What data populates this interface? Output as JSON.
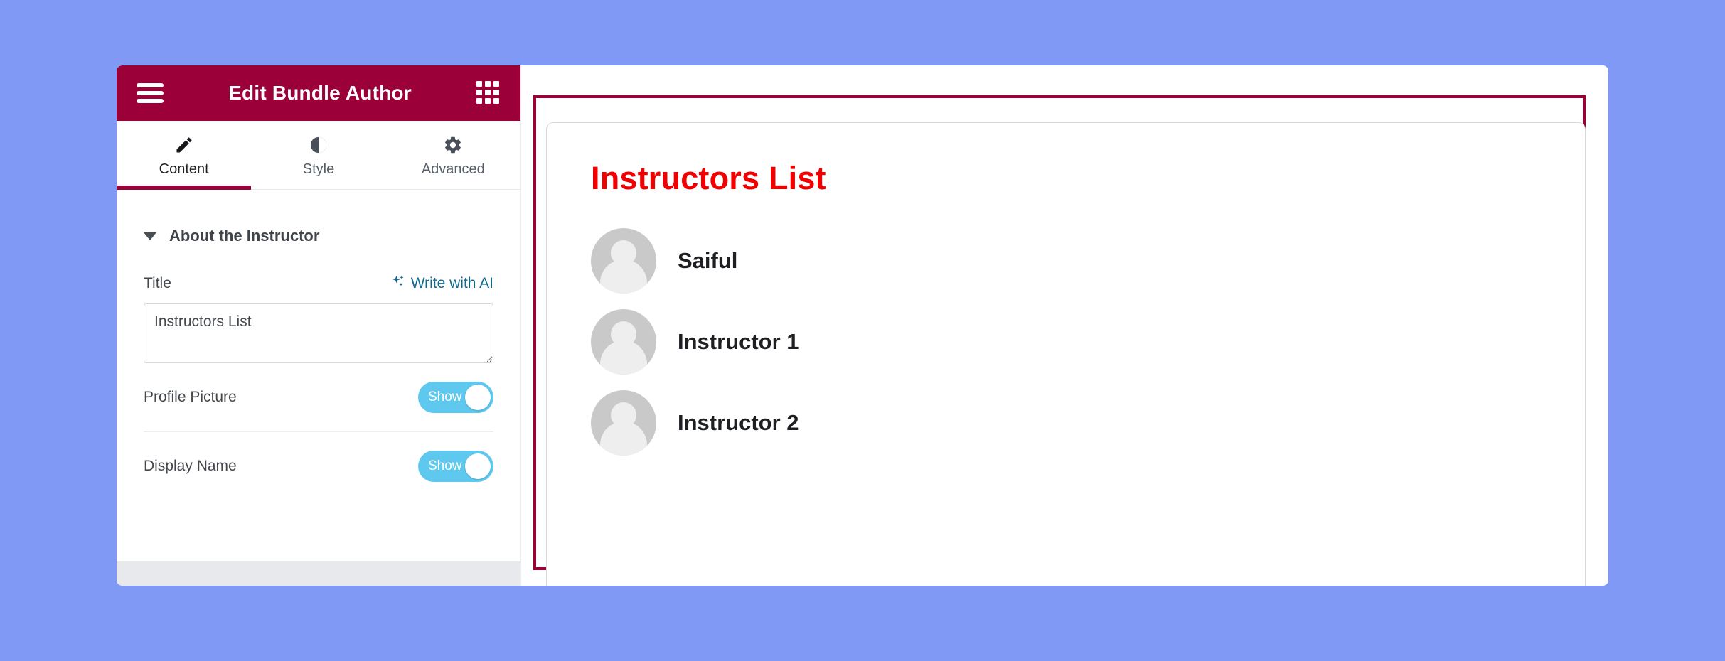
{
  "theme": {
    "background": "#8099f5",
    "header_bar": "#9b0039",
    "accent": "#9b0039",
    "toggle_on": "#5ec8ef",
    "link": "#11698e",
    "preview_heading": "#f00000"
  },
  "panel": {
    "header": {
      "title": "Edit Bundle Author",
      "menu_icon": "hamburger-icon",
      "apps_icon": "grid-icon"
    },
    "tabs": [
      {
        "label": "Content",
        "icon": "pencil-icon",
        "active": true
      },
      {
        "label": "Style",
        "icon": "contrast-icon",
        "active": false
      },
      {
        "label": "Advanced",
        "icon": "gear-icon",
        "active": false
      }
    ],
    "section": {
      "title": "About the Instructor",
      "expanded": true,
      "caret_icon": "caret-down-icon"
    },
    "fields": {
      "title_label": "Title",
      "write_with_ai_label": "Write with AI",
      "write_with_ai_icon": "sparkle-icon",
      "title_value": "Instructors List",
      "title_placeholder": ""
    },
    "toggles": [
      {
        "label": "Profile Picture",
        "state": "Show"
      },
      {
        "label": "Display Name",
        "state": "Show"
      }
    ]
  },
  "preview": {
    "heading": "Instructors List",
    "instructors": [
      {
        "name": "Saiful",
        "avatar": "user-avatar-icon"
      },
      {
        "name": "Instructor 1",
        "avatar": "user-avatar-icon"
      },
      {
        "name": "Instructor 2",
        "avatar": "user-avatar-icon"
      }
    ]
  }
}
